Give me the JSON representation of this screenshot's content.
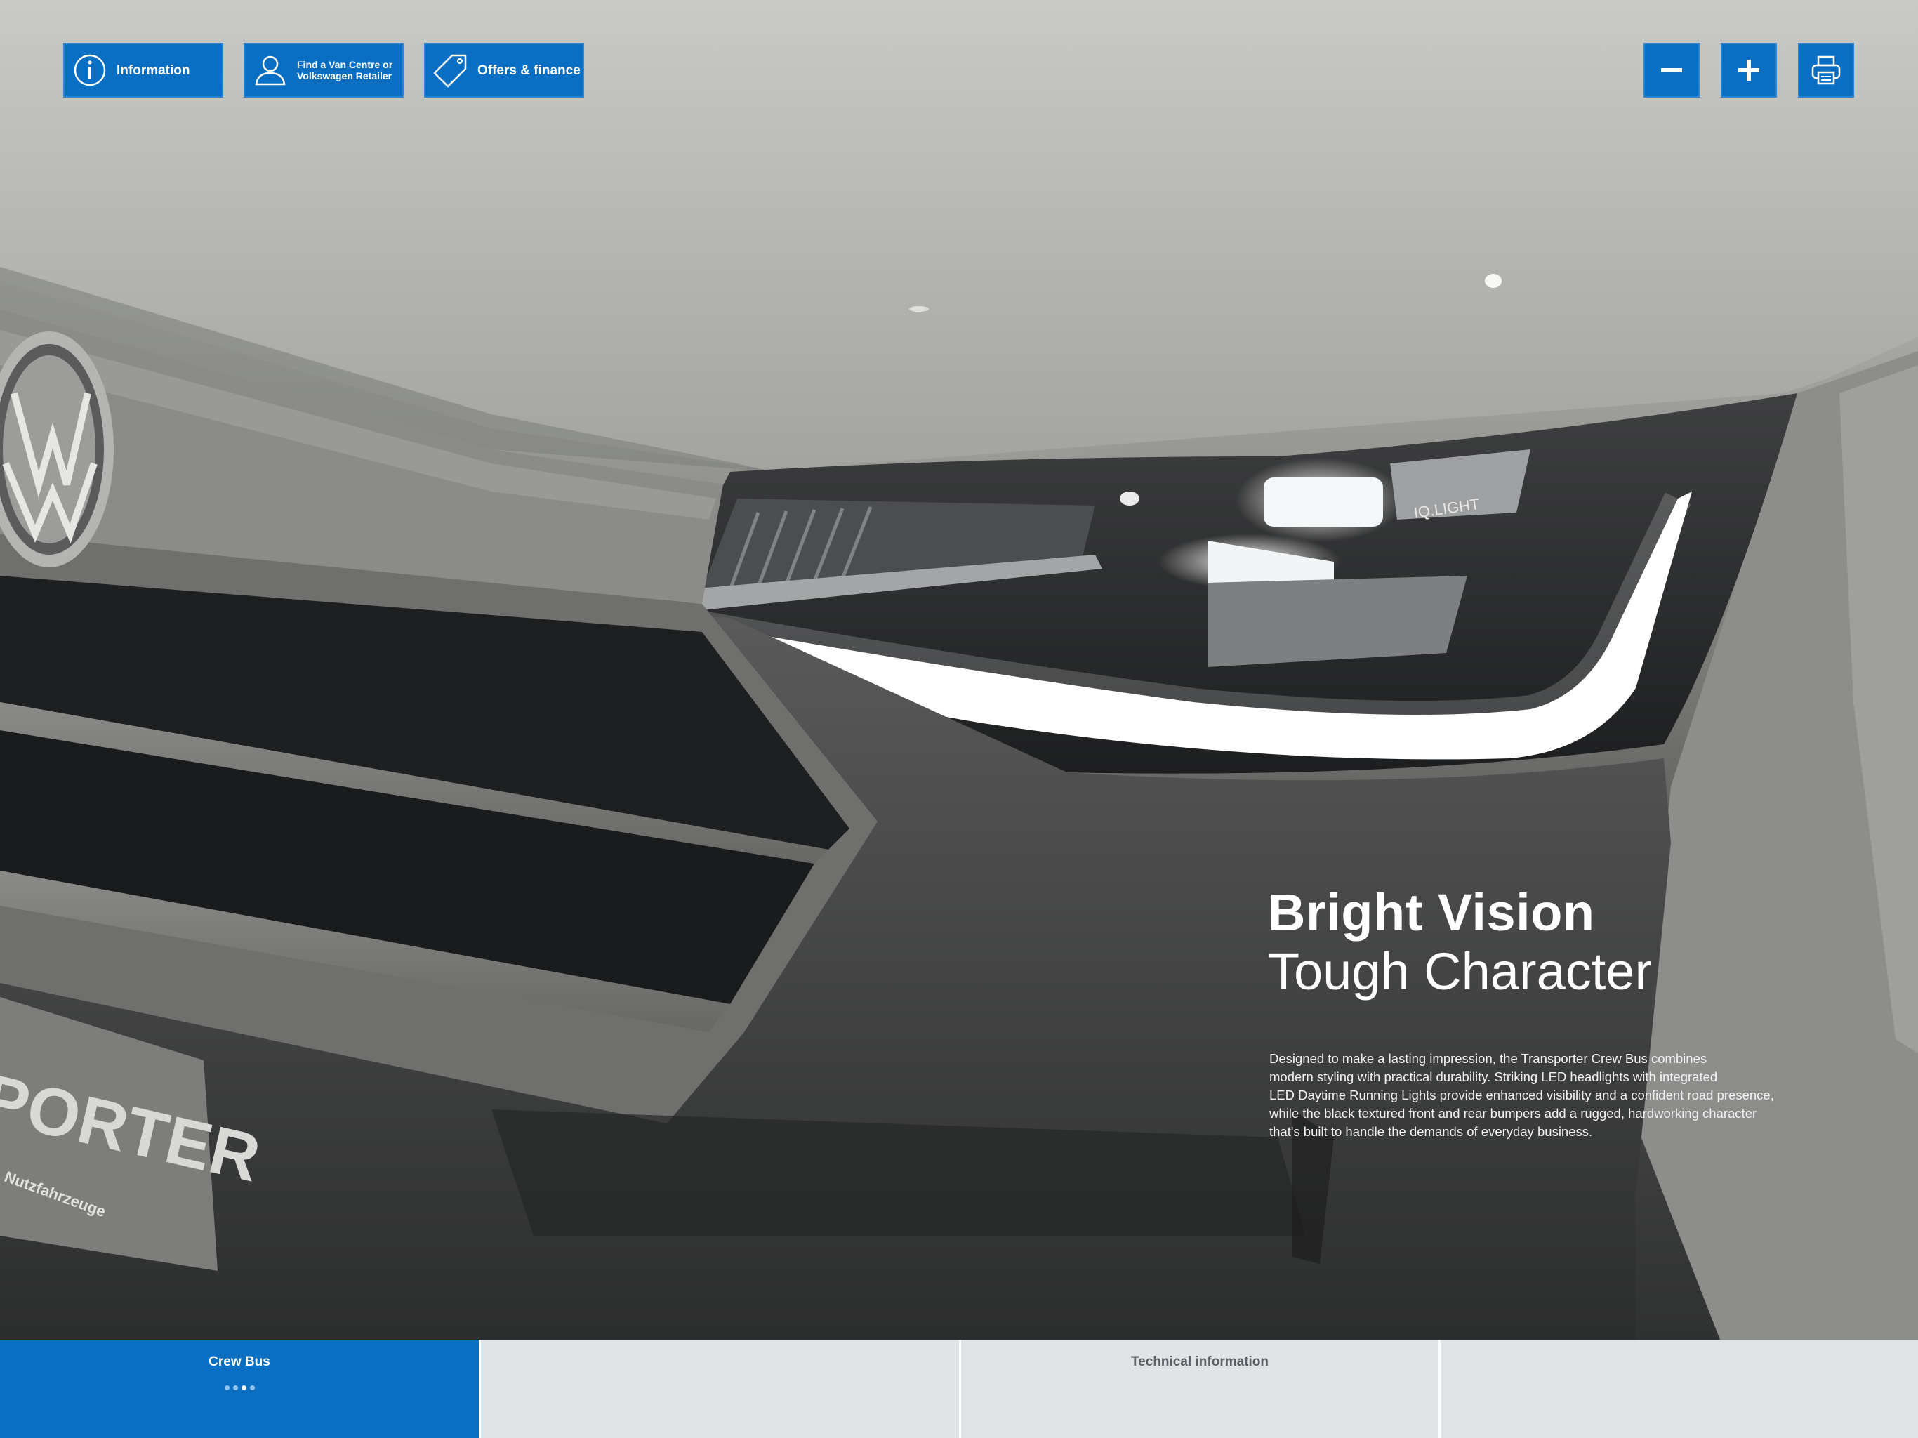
{
  "toolbar": {
    "information_label": "Information",
    "find_retailer_label_line1": "Find a Van Centre or",
    "find_retailer_label_line2": "Volkswagen Retailer",
    "offers_label": "Offers & finance",
    "icons": {
      "information": "info-circle-icon",
      "find_retailer": "person-icon",
      "offers": "price-tag-icon",
      "zoom_out": "minus-icon",
      "zoom_in": "plus-icon",
      "print": "printer-icon"
    },
    "accent_color": "#0a6fc2"
  },
  "hero": {
    "headlight_badge": "IQ.LIGHT",
    "plate_text": "PORTER",
    "plate_subtext": "Nutzfahrzeuge"
  },
  "content": {
    "title_bold": "Bright Vision",
    "title_light": "Tough Character",
    "body_lines": [
      "Designed to make a lasting impression, the Transporter Crew Bus combines",
      "modern styling with practical durability. Striking LED headlights with integrated",
      "LED Daytime Running Lights provide enhanced visibility and a confident road presence,",
      "while the black textured front and rear bumpers add a rugged, hardworking character",
      "that's built to handle the demands of everyday business."
    ]
  },
  "tabs": [
    {
      "label": "Crew Bus",
      "active": true,
      "page_dots": 4,
      "current_dot": 3
    },
    {
      "label": "",
      "active": false
    },
    {
      "label": "Technical information",
      "active": false
    },
    {
      "label": "",
      "active": false
    }
  ]
}
